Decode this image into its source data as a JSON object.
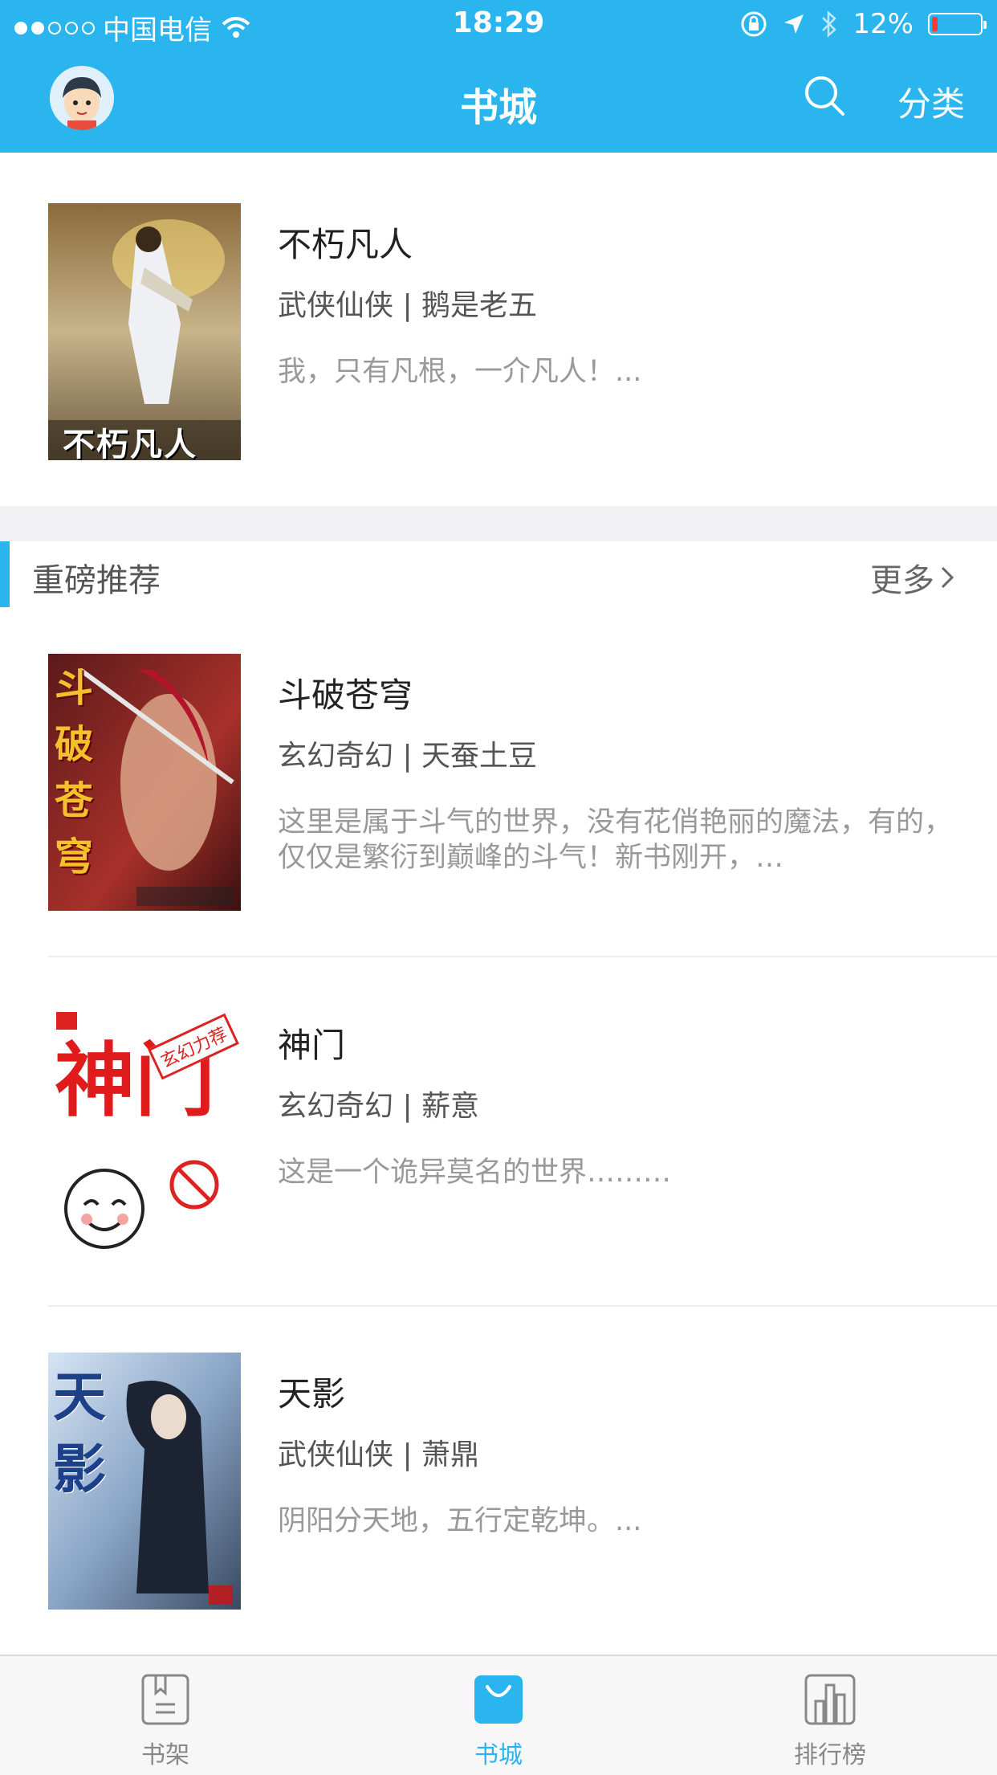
{
  "status_bar": {
    "carrier": "中国电信",
    "time": "18:29",
    "battery": "12%",
    "battery_level": 0.12
  },
  "header": {
    "title": "书城",
    "category_label": "分类"
  },
  "featured": {
    "title": "不朽凡人",
    "meta": "武侠仙侠 | 鹅是老五",
    "desc": "我，只有凡根，一介凡人！...",
    "cover_text": "不朽凡人"
  },
  "section": {
    "title": "重磅推荐",
    "more": "更多"
  },
  "books": [
    {
      "title": "斗破苍穹",
      "meta": "玄幻奇幻 | 天蚕土豆",
      "desc": "这里是属于斗气的世界，没有花俏艳丽的魔法，有的，仅仅是繁衍到巅峰的斗气！新书刚开，…",
      "cover_text": "斗破苍穹"
    },
    {
      "title": "神门",
      "meta": "玄幻奇幻 | 薪意",
      "desc": "这是一个诡异莫名的世界………",
      "cover_text": "神门",
      "cover_badge": "玄幻力荐"
    },
    {
      "title": "天影",
      "meta": "武侠仙侠 | 萧鼎",
      "desc": "阴阳分天地，五行定乾坤。...",
      "cover_text": "天影"
    }
  ],
  "tabbar": {
    "tabs": [
      {
        "label": "书架",
        "icon": "bookshelf-icon"
      },
      {
        "label": "书城",
        "icon": "bookstore-bag-icon",
        "active": true
      },
      {
        "label": "排行榜",
        "icon": "ranking-chart-icon"
      }
    ]
  },
  "colors": {
    "accent": "#2bb5ef",
    "background": "#ffffff",
    "section_gap": "#f2f2f4"
  }
}
